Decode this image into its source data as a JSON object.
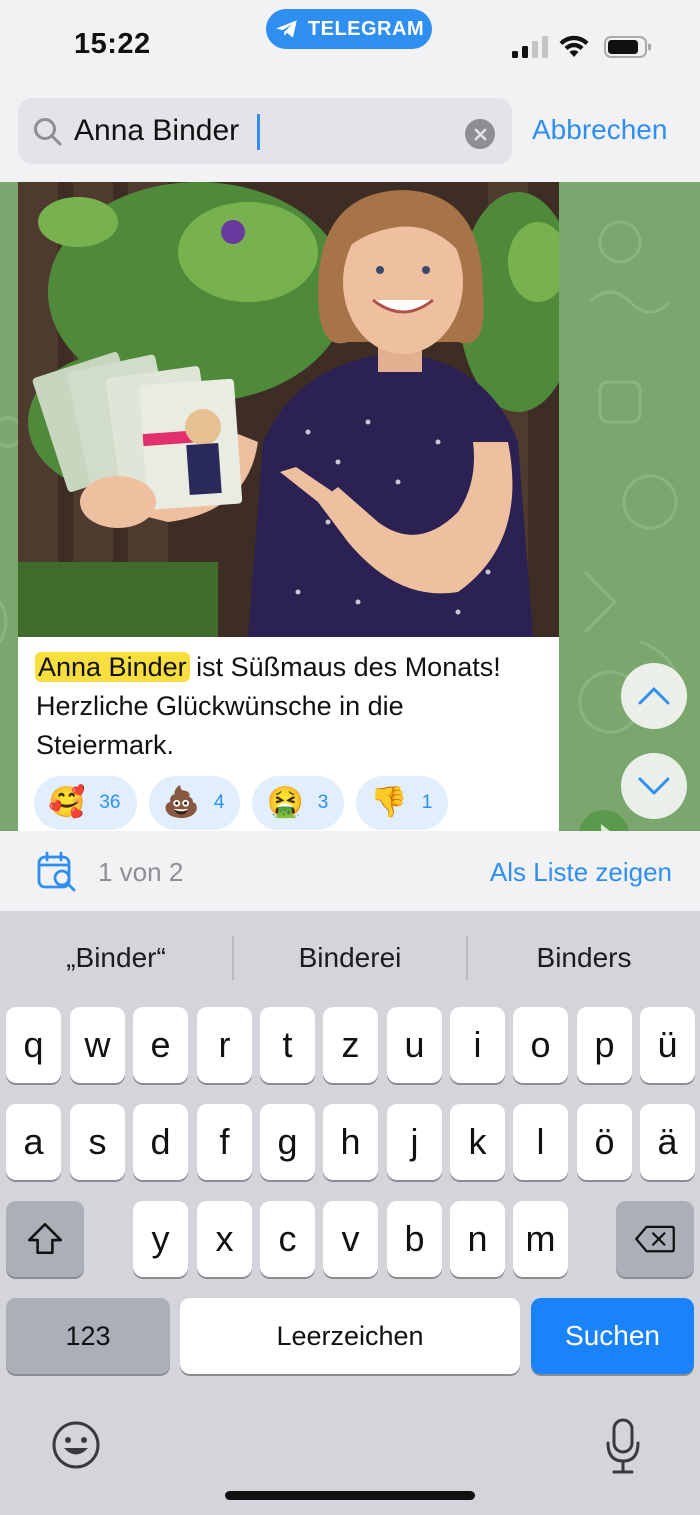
{
  "status_bar": {
    "time": "15:22",
    "app_pill": "TELEGRAM",
    "icons": [
      "signal-icon",
      "wifi-icon",
      "battery-icon"
    ]
  },
  "search": {
    "query": "Anna Binder",
    "cancel_label": "Abbrechen"
  },
  "message": {
    "photo_alt": "",
    "caption_highlight": "Anna Binder",
    "caption_rest": " ist Süßmaus des Monats! Herzliche Glückwünsche in die Steiermark.",
    "reactions": [
      {
        "emoji": "🥰",
        "count": "36"
      },
      {
        "emoji": "💩",
        "count": "4"
      },
      {
        "emoji": "🤮",
        "count": "3"
      },
      {
        "emoji": "👎",
        "count": "1"
      }
    ]
  },
  "results_bar": {
    "count_text": "1 von 2",
    "list_link": "Als Liste zeigen"
  },
  "keyboard": {
    "suggestions": [
      "„Binder“",
      "Binderei",
      "Binders"
    ],
    "row1": [
      "q",
      "w",
      "e",
      "r",
      "t",
      "z",
      "u",
      "i",
      "o",
      "p",
      "ü"
    ],
    "row2": [
      "a",
      "s",
      "d",
      "f",
      "g",
      "h",
      "j",
      "k",
      "l",
      "ö",
      "ä"
    ],
    "row3": [
      "y",
      "x",
      "c",
      "v",
      "b",
      "n",
      "m"
    ],
    "numbers_label": "123",
    "space_label": "Leerzeichen",
    "search_label": "Suchen"
  },
  "colors": {
    "accent": "#2f8ff0",
    "chat_background": "#7ba76e",
    "highlight": "#f8df3f",
    "search_key": "#1a82fb"
  }
}
